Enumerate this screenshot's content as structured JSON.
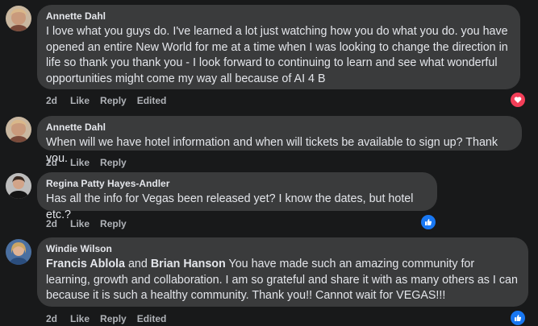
{
  "comments": [
    {
      "author": "Annette Dahl",
      "text": "I love what you guys do. I've learned a lot just watching how you do what you do. you have opened an entire New World for me at a time when I was looking to change the direction in life so thank you thank you - I look forward to continuing to learn and see what wonderful opportunities might come my way all because of AI 4 B",
      "time": "2d",
      "like": "Like",
      "reply": "Reply",
      "edited": "Edited",
      "reaction": "love-icon"
    },
    {
      "author": "Annette Dahl",
      "text": "When will we have hotel information and when will tickets be available to sign up? Thank you.",
      "time": "2d",
      "like": "Like",
      "reply": "Reply"
    },
    {
      "author": "Regina Patty Hayes-Andler",
      "text": "Has all the info for Vegas been released yet? I know the dates, but hotel etc.?",
      "time": "2d",
      "like": "Like",
      "reply": "Reply",
      "reaction": "like-icon"
    },
    {
      "author": "Windie Wilson",
      "mention1": "Francis Ablola",
      "and": "and",
      "mention2": "Brian Hanson",
      "text": "You have made such an amazing community for learning, growth and collaboration. I am so grateful and share it with as many others as I can because it is such a healthy community. Thank you!! Cannot wait for VEGAS!!!",
      "time": "2d",
      "like": "Like",
      "reply": "Reply",
      "edited": "Edited",
      "reaction": "like-icon"
    }
  ],
  "colors": {
    "background": "#18191a",
    "bubble": "#3a3b3c",
    "text": "#e4e6eb",
    "muted": "#b0b3b8",
    "love": "#f33e58",
    "like": "#1877f2"
  }
}
